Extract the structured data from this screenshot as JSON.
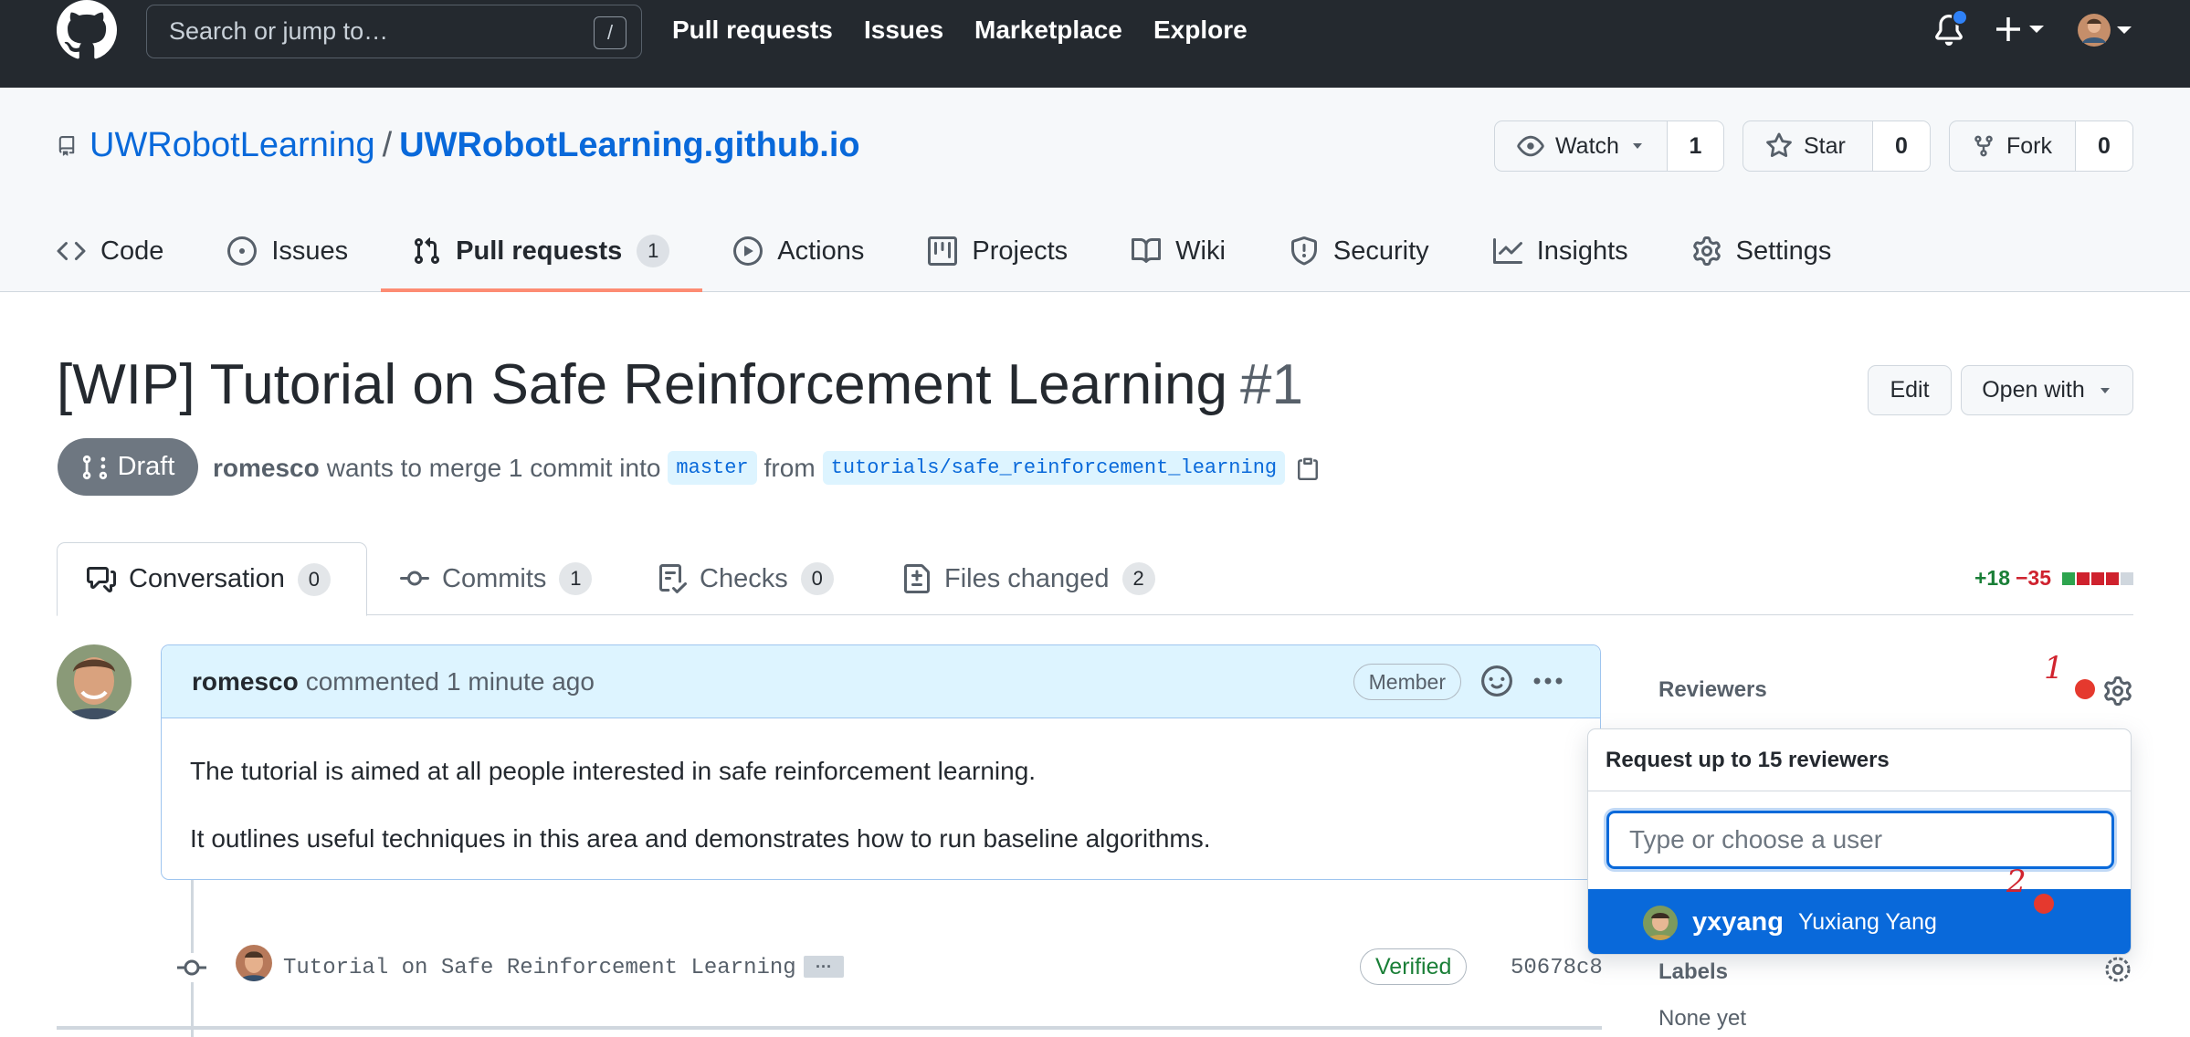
{
  "header": {
    "search_placeholder": "Search or jump to…",
    "search_key": "/",
    "nav": [
      "Pull requests",
      "Issues",
      "Marketplace",
      "Explore"
    ]
  },
  "repo": {
    "owner": "UWRobotLearning",
    "separator": "/",
    "name": "UWRobotLearning.github.io",
    "watch_label": "Watch",
    "watch_count": "1",
    "star_label": "Star",
    "star_count": "0",
    "fork_label": "Fork",
    "fork_count": "0",
    "tabs": [
      {
        "label": "Code",
        "icon": "code-icon"
      },
      {
        "label": "Issues",
        "icon": "issue-icon"
      },
      {
        "label": "Pull requests",
        "icon": "pull-request-icon",
        "count": "1",
        "active": true
      },
      {
        "label": "Actions",
        "icon": "play-icon"
      },
      {
        "label": "Projects",
        "icon": "project-icon"
      },
      {
        "label": "Wiki",
        "icon": "book-icon"
      },
      {
        "label": "Security",
        "icon": "shield-icon"
      },
      {
        "label": "Insights",
        "icon": "graph-icon"
      },
      {
        "label": "Settings",
        "icon": "gear-icon"
      }
    ]
  },
  "pr": {
    "title": "[WIP] Tutorial on Safe Reinforcement Learning",
    "number": "#1",
    "edit_label": "Edit",
    "open_with_label": "Open with",
    "state": "Draft",
    "author": "romesco",
    "merge_text": "wants to merge 1 commit into",
    "base_branch": "master",
    "from_text": "from",
    "head_branch": "tutorials/safe_reinforcement_learning",
    "tabs": [
      {
        "label": "Conversation",
        "count": "0"
      },
      {
        "label": "Commits",
        "count": "1"
      },
      {
        "label": "Checks",
        "count": "0"
      },
      {
        "label": "Files changed",
        "count": "2"
      }
    ],
    "additions": "+18",
    "deletions": "−35"
  },
  "comment": {
    "author": "romesco",
    "action": "commented",
    "time": "1 minute ago",
    "role": "Member",
    "body": [
      "The tutorial is aimed at all people interested in safe reinforcement learning.",
      "It outlines useful techniques in this area and demonstrates how to run baseline algorithms."
    ]
  },
  "commit": {
    "message": "Tutorial on Safe Reinforcement Learning",
    "ellipsis": "···",
    "verified": "Verified",
    "sha": "50678c8"
  },
  "sidebar": {
    "reviewers_label": "Reviewers",
    "annotation_1": "1",
    "annotation_2": "2",
    "popup_title": "Request up to 15 reviewers",
    "popup_placeholder": "Type or choose a user",
    "suggestion_login": "yxyang",
    "suggestion_name": "Yuxiang Yang",
    "labels_label": "Labels",
    "labels_value": "None yet"
  },
  "colors": {
    "header_bg": "#24292f",
    "link": "#0969da",
    "active_tab": "#fd8c73",
    "draft": "#6e7781",
    "addition": "#1a7f37",
    "deletion": "#cf222e",
    "annotation": "#e5392e"
  }
}
